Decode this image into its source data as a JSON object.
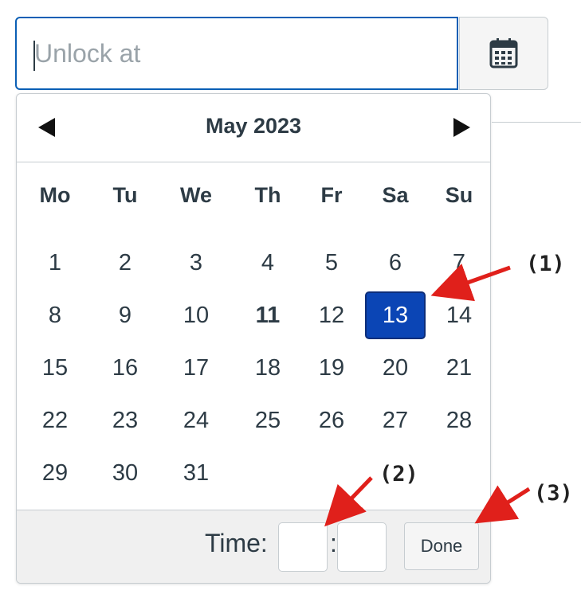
{
  "input": {
    "placeholder": "Unlock at"
  },
  "calendar": {
    "month_label": "May 2023",
    "weekdays": [
      "Mo",
      "Tu",
      "We",
      "Th",
      "Fr",
      "Sa",
      "Su"
    ],
    "weeks": [
      [
        "1",
        "2",
        "3",
        "4",
        "5",
        "6",
        "7"
      ],
      [
        "8",
        "9",
        "10",
        "11",
        "12",
        "13",
        "14"
      ],
      [
        "15",
        "16",
        "17",
        "18",
        "19",
        "20",
        "21"
      ],
      [
        "22",
        "23",
        "24",
        "25",
        "26",
        "27",
        "28"
      ],
      [
        "29",
        "30",
        "31",
        "",
        "",
        "",
        ""
      ]
    ],
    "today": "11",
    "selected": "13"
  },
  "footer": {
    "time_label": "Time:",
    "colon": ":",
    "hour_value": "",
    "minute_value": "",
    "done_label": "Done"
  },
  "annotations": {
    "a1": "(1)",
    "a2": "(2)",
    "a3": "(3)"
  },
  "colors": {
    "accent": "#0b45b5",
    "arrow": "#e0201b"
  }
}
